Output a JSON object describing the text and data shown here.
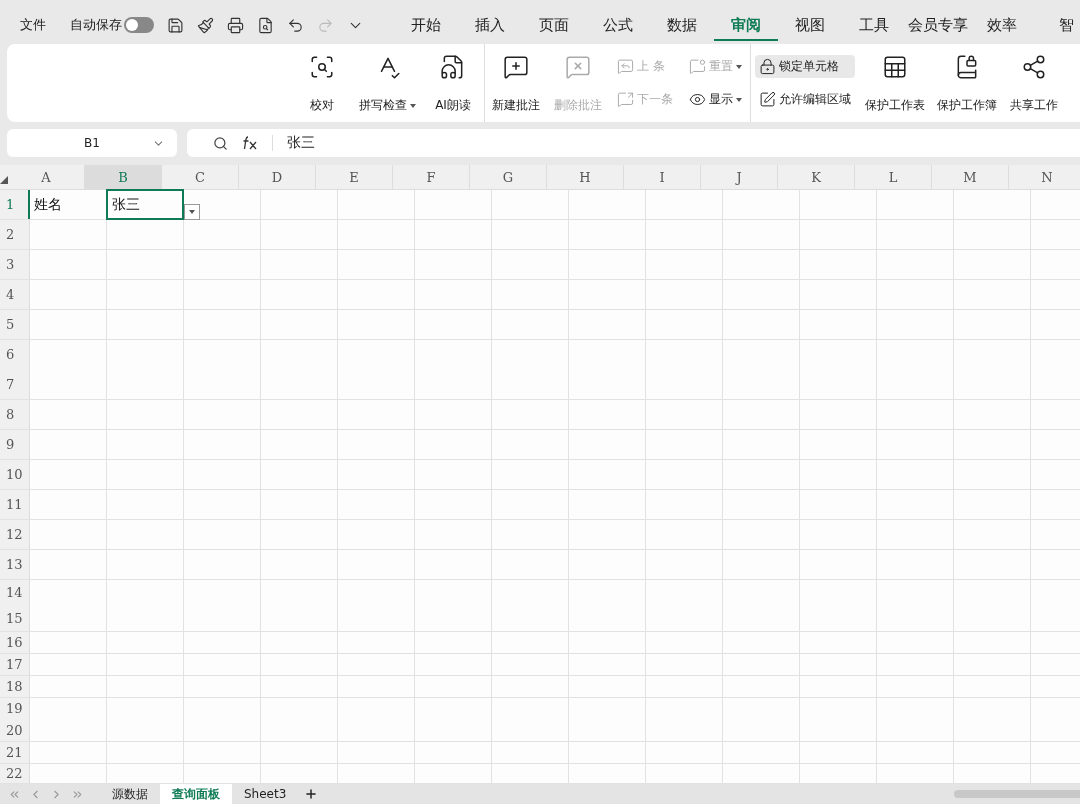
{
  "menubar": {
    "file": "文件",
    "autosave": {
      "label": "自动保存",
      "on": false
    },
    "quick_actions": [
      {
        "kind": "save",
        "disabled": false
      },
      {
        "kind": "painter",
        "disabled": false
      },
      {
        "kind": "print",
        "disabled": false
      },
      {
        "kind": "preview",
        "disabled": false
      },
      {
        "kind": "undo",
        "disabled": false
      },
      {
        "kind": "redo",
        "disabled": true
      },
      {
        "kind": "more",
        "disabled": false
      }
    ]
  },
  "tabs": [
    {
      "label": "开始",
      "selected": false
    },
    {
      "label": "插入",
      "selected": false
    },
    {
      "label": "页面",
      "selected": false
    },
    {
      "label": "公式",
      "selected": false
    },
    {
      "label": "数据",
      "selected": false
    },
    {
      "label": "审阅",
      "selected": true
    },
    {
      "label": "视图",
      "selected": false
    },
    {
      "label": "工具",
      "selected": false
    },
    {
      "label": "会员专享",
      "selected": false
    },
    {
      "label": "效率",
      "selected": false
    },
    {
      "label": "智",
      "selected": false
    }
  ],
  "ribbon": {
    "groups": [
      {
        "columns": [
          {
            "kind": "large",
            "label": "校对",
            "dropdown": false,
            "disabled": false
          },
          {
            "kind": "large",
            "label": "拼写检查",
            "dropdown": true,
            "disabled": false
          },
          {
            "kind": "large",
            "label": "AI朗读",
            "dropdown": false,
            "disabled": false
          }
        ]
      },
      {
        "columns": [
          {
            "kind": "large",
            "label": "新建批注",
            "dropdown": false,
            "disabled": false
          },
          {
            "kind": "large",
            "label": "删除批注",
            "dropdown": false,
            "disabled": true
          },
          {
            "kind": "stack",
            "items": [
              {
                "label": "上 条",
                "dropdown": false,
                "disabled": true,
                "highlighted": false
              },
              {
                "label": "下一条",
                "dropdown": false,
                "disabled": true,
                "highlighted": false
              }
            ]
          },
          {
            "kind": "stack",
            "items": [
              {
                "label": "重置",
                "dropdown": true,
                "disabled": true,
                "highlighted": false
              },
              {
                "label": "显示",
                "dropdown": true,
                "disabled": false,
                "highlighted": false
              }
            ]
          }
        ]
      },
      {
        "columns": [
          {
            "kind": "stack",
            "items": [
              {
                "label": "锁定单元格",
                "dropdown": false,
                "disabled": false,
                "highlighted": true
              },
              {
                "label": "允许编辑区域",
                "dropdown": false,
                "disabled": false,
                "highlighted": false
              }
            ]
          },
          {
            "kind": "large",
            "label": "保护工作表",
            "dropdown": false,
            "disabled": false
          },
          {
            "kind": "large",
            "label": "保护工作簿",
            "dropdown": false,
            "disabled": false
          },
          {
            "kind": "large",
            "label": "共享工作",
            "dropdown": false,
            "disabled": false
          }
        ]
      }
    ]
  },
  "formula_bar": {
    "name_box": "B1",
    "formula": "张三"
  },
  "grid": {
    "columns": [
      {
        "label": "A",
        "selected": false
      },
      {
        "label": "B",
        "selected": true
      },
      {
        "label": "C",
        "selected": false
      },
      {
        "label": "D",
        "selected": false
      },
      {
        "label": "E",
        "selected": false
      },
      {
        "label": "F",
        "selected": false
      },
      {
        "label": "G",
        "selected": false
      },
      {
        "label": "H",
        "selected": false
      },
      {
        "label": "I",
        "selected": false
      },
      {
        "label": "J",
        "selected": false
      },
      {
        "label": "K",
        "selected": false
      },
      {
        "label": "L",
        "selected": false
      },
      {
        "label": "M",
        "selected": false
      },
      {
        "label": "N",
        "selected": false
      }
    ],
    "rows": [
      {
        "labels": [
          "1"
        ],
        "selected": true,
        "cells": [
          {
            "text": "姓名",
            "selected": false
          },
          {
            "text": "张三",
            "selected": true,
            "dropdown": true
          }
        ]
      },
      {
        "labels": [
          "2"
        ],
        "selected": false
      },
      {
        "labels": [
          "3"
        ],
        "selected": false
      },
      {
        "labels": [
          "4"
        ],
        "selected": false
      },
      {
        "labels": [
          "5"
        ],
        "selected": false
      },
      {
        "labels": [
          "6",
          "7"
        ],
        "selected": false
      },
      {
        "labels": [
          "8"
        ],
        "selected": false
      },
      {
        "labels": [
          "9"
        ],
        "selected": false
      },
      {
        "labels": [
          "10"
        ],
        "selected": false
      },
      {
        "labels": [
          "11"
        ],
        "selected": false
      },
      {
        "labels": [
          "12"
        ],
        "selected": false
      },
      {
        "labels": [
          "13"
        ],
        "selected": false
      },
      {
        "labels": [
          "14",
          "15"
        ],
        "selected": false
      },
      {
        "labels": [
          "16"
        ],
        "selected": false
      },
      {
        "labels": [
          "17"
        ],
        "selected": false
      },
      {
        "labels": [
          "18"
        ],
        "selected": false
      },
      {
        "labels": [
          "19",
          "20"
        ],
        "selected": false
      },
      {
        "labels": [
          "21"
        ],
        "selected": false
      },
      {
        "labels": [
          "22"
        ],
        "selected": false
      }
    ]
  },
  "sheets": [
    {
      "label": "源数据",
      "selected": false
    },
    {
      "label": "查询面板",
      "selected": true
    },
    {
      "label": "Sheet3",
      "selected": false
    }
  ]
}
